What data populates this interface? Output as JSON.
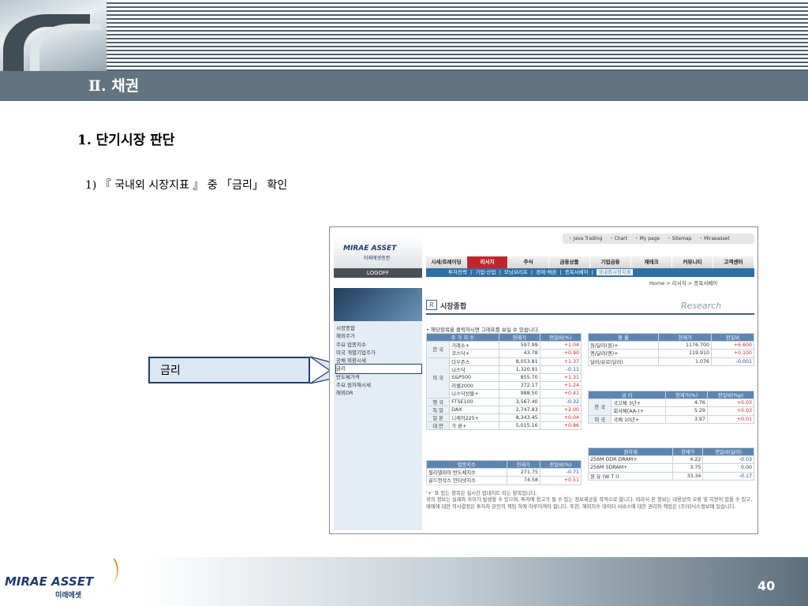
{
  "slide": {
    "section_title": "Ⅱ. 채권",
    "heading": "1. 단기시장 판단",
    "subheading": "1) 『 국내외 시장지표 』 중 「금리」 확인",
    "callout": "금리",
    "page_number": "40",
    "footer_logo": "MIRAE ASSET",
    "footer_logo_sub": "미래에셋"
  },
  "site": {
    "logo": "MIRAE ASSET",
    "logo_sub": "미래에셋증권",
    "logoff": "LOGOFF",
    "top_links": [
      "Java Trading",
      "Chart",
      "My page",
      "Sitemap",
      "Miraeasset"
    ],
    "tabs": [
      "시세/트레이딩",
      "리서치",
      "주식",
      "금융상품",
      "기업금융",
      "재테크",
      "커뮤니티",
      "고객센터"
    ],
    "active_tab": "리서치",
    "subnav": [
      "투자전략",
      "기업·산업",
      "모닝브리프",
      "경제·채권",
      "종목서베이",
      "국내외시장지표"
    ],
    "breadcrumb": "Home > 리서치 > 종목서베이",
    "sidebar": [
      "시장종합",
      "해외주가",
      "주요 업종지수",
      "미국 개별기업주가",
      "공채 외환시세",
      "금리",
      "반도체가격",
      "주요 원자재시세",
      "해외DR"
    ],
    "page_title": "시장종합",
    "research_label": "Research",
    "hint": "• 해당항목을 클릭하시면 그래프를 보실 수 있습니다.",
    "index_table": {
      "headers": [
        "주 가 지 수",
        "현재가",
        "전일비(%)"
      ],
      "rows": [
        {
          "region": "한 국",
          "name": "거래소+",
          "price": "597.99",
          "change": "+1.04"
        },
        {
          "region": "",
          "name": "코스닥+",
          "price": "43.78",
          "change": "+0.90"
        },
        {
          "region": "미 국",
          "name": "다우존스",
          "price": "8,053.81",
          "change": "+1.37"
        },
        {
          "region": "",
          "name": "나스닥",
          "price": "1,320.91",
          "change": "-0.11"
        },
        {
          "region": "",
          "name": "S&P500",
          "price": "855.70",
          "change": "+1.31"
        },
        {
          "region": "",
          "name": "러셀2000",
          "price": "372.17",
          "change": "+1.24"
        },
        {
          "region": "",
          "name": "나스닥선물+",
          "price": "988.50",
          "change": "+0.41"
        },
        {
          "region": "영 국",
          "name": "FTSE100",
          "price": "3,567.40",
          "change": "-0.32"
        },
        {
          "region": "독 일",
          "name": "DAX",
          "price": "2,747.83",
          "change": "+2.00"
        },
        {
          "region": "일 본",
          "name": "니케이225+",
          "price": "8,343.45",
          "change": "+0.04"
        },
        {
          "region": "대 만",
          "name": "가 권+",
          "price": "5,015.16",
          "change": "+0.86"
        }
      ]
    },
    "sector_table": {
      "headers": [
        "업종지수",
        "현재가",
        "전일비(%)"
      ],
      "rows": [
        {
          "name": "필라델피아 반도체지수",
          "price": "271.75",
          "change": "-0.71"
        },
        {
          "name": "골드만삭스 인터넷지수",
          "price": "74.58",
          "change": "+0.51"
        }
      ]
    },
    "fx_table": {
      "headers": [
        "환 율",
        "현재가",
        "전일비"
      ],
      "rows": [
        {
          "name": "원/달러(원)+",
          "price": "1176.700",
          "change": "+6.600"
        },
        {
          "name": "엔/달러(엔)+",
          "price": "119.910",
          "change": "+0.100"
        },
        {
          "name": "달러/유로(달러)",
          "price": "1.076",
          "change": "-0.001"
        }
      ]
    },
    "rate_table": {
      "headers": [
        "금 리",
        "현재가(%)",
        "전일비(%p)"
      ],
      "rows": [
        {
          "region": "한 국",
          "name": "국고채 3년+",
          "price": "4.76",
          "change": "+0.03"
        },
        {
          "region": "",
          "name": "회사채(AA-)+",
          "price": "5.29",
          "change": "+0.03"
        },
        {
          "region": "미 국",
          "name": "국채 10년+",
          "price": "3.97",
          "change": "+0.01"
        }
      ]
    },
    "commodity_table": {
      "headers": [
        "원자재",
        "현재가",
        "전일비(달러)"
      ],
      "rows": [
        {
          "name": "256M DDR DRAM+",
          "price": "4.22",
          "change": "-0.03"
        },
        {
          "name": "256M SDRAM+",
          "price": "3.75",
          "change": "0.00"
        },
        {
          "name": "원 유 (W T I)",
          "price": "33.34",
          "change": "-0.17"
        }
      ]
    },
    "star_note": "'+' 표 있는 항목은 실시간 업데이트 되는 항목입니다.",
    "disclaimer": "위의 정보는 실제와 차이가 발생할 수 있으며, 투자에 참고가 될 수 있는 정보제공을 목적으로 합니다. 따라서 본 정보는 내용상의 오류 및 지연이 있을 수 있고, 매매에 대한 의사결정은 투자자 본인의 책임 하에 이루어져야 합니다. 또한, 해외지수 데이터 서비스에 대한 권리와 책임은 (주)위닉스정보에 있습니다."
  }
}
